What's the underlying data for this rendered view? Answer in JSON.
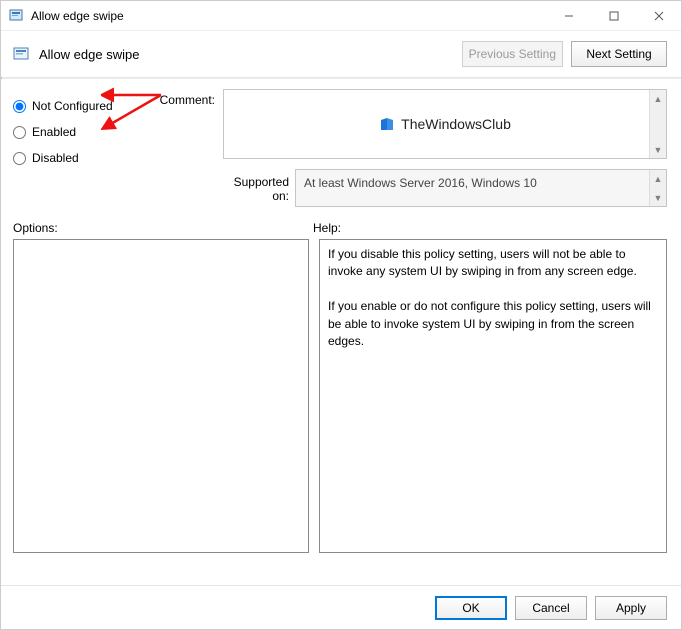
{
  "window": {
    "title": "Allow edge swipe"
  },
  "header": {
    "title": "Allow edge swipe",
    "prev_label": "Previous Setting",
    "next_label": "Next Setting"
  },
  "radios": {
    "not_configured": "Not Configured",
    "enabled": "Enabled",
    "disabled": "Disabled",
    "selected": "not_configured"
  },
  "comment": {
    "label": "Comment:",
    "watermark_text": "TheWindowsClub"
  },
  "supported": {
    "label": "Supported on:",
    "value": "At least Windows Server 2016, Windows 10"
  },
  "panes": {
    "options_label": "Options:",
    "help_label": "Help:",
    "help_text_1": "If you disable this policy setting, users will not be able to invoke any system UI by swiping in from any screen edge.",
    "help_text_2": "If you enable or do not configure this policy setting, users will be able to invoke system UI by swiping in from the screen edges."
  },
  "footer": {
    "ok": "OK",
    "cancel": "Cancel",
    "apply": "Apply"
  }
}
